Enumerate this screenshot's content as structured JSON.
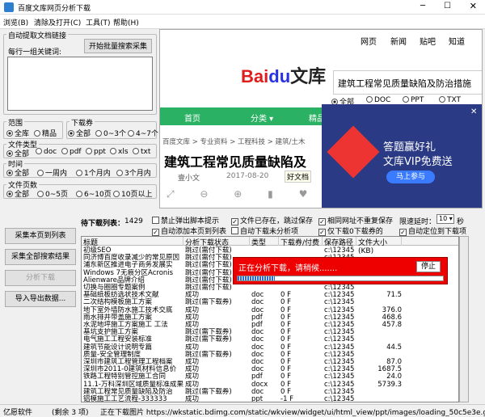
{
  "window": {
    "title": "百度文库网页分析下载"
  },
  "menu": [
    "浏览(B)",
    "清除及打开(C)",
    "工具(T)",
    "帮助(H)"
  ],
  "left": {
    "auto_group": "自动提取文档链接",
    "keyword_label": "每行一组关键词:",
    "batch_btn": "开始批量搜索采集",
    "range_group": "范围",
    "range_opts": [
      "全库",
      "精品"
    ],
    "coupon_group": "下载券",
    "coupon_opts": [
      "全部",
      "0~3个",
      "4~7个"
    ],
    "type_group": "文件类型",
    "type_opts": [
      "全部",
      "doc",
      "pdf",
      "ppt",
      "xls",
      "txt"
    ],
    "time_group": "时间",
    "time_opts": [
      "全部",
      "一周内",
      "1个月内",
      "3个月内"
    ],
    "pages_group": "文件页数",
    "pages_opts": [
      "全部",
      "0~5页",
      "6~10页",
      "10页以上"
    ]
  },
  "browser": {
    "nav": [
      "网页",
      "新闻",
      "贴吧",
      "知道"
    ],
    "logo_a": "Bai",
    "logo_b": "du",
    "logo_c": "文库",
    "search": "建筑工程常见质量缺陷及防治措施",
    "filters": [
      "全部",
      "DOC",
      "PPT",
      "TXT"
    ],
    "green": [
      "首页",
      "分类 ▾",
      "精品"
    ],
    "crumb": "百度文库 > 专业资料 > 工程科技 > 建筑/土木",
    "doctitle": "建筑工程常见质量缺陷及",
    "author": "壹小文",
    "date": "2017-08-20",
    "doc_badge": "好文档",
    "ad_line1": "答题赢好礼",
    "ad_line2": "文库VIP免费送",
    "ad_btn": "马上参与"
  },
  "controls": {
    "btn_collect_page": "采集本页到列表",
    "btn_collect_all": "采集全部搜索结果",
    "btn_analyze": "分析下载",
    "btn_import": "导入导出数据...",
    "list_label": "待下载列表：",
    "list_count": "1429",
    "opt1": "禁止弹出脚本提示",
    "opt2": "文件已存在，跳过保存",
    "opt3": "相同网址不重复保存",
    "opt4": "自动添加本页到列表",
    "opt5": "自动下载未分析项",
    "opt6": "仅下载0下载券的",
    "opt7": "自动定位到下载项",
    "speed_label": "限速延时：",
    "speed_val": "10",
    "speed_unit": "秒"
  },
  "table": {
    "headers": [
      "标题",
      "分析下载状态",
      "类型",
      "下载券/付费",
      "保存路径",
      "文件大小(KB)"
    ],
    "rows": [
      [
        "初级SEO",
        "跳过(需付下载)",
        "",
        "",
        "c:\\12345",
        ""
      ],
      [
        "同济博百度收录减少的常见原因",
        "跳过(需付下载)",
        "",
        "",
        "c:\\12345",
        ""
      ],
      [
        "浦东新区推进电子商务发展实",
        "跳过(需付下载)",
        "",
        "",
        "c:\\12345",
        ""
      ],
      [
        "Windows 7无痕分区Acronis",
        "跳过(需付下载)",
        "",
        "",
        "c:\\12345",
        ""
      ],
      [
        "Alienware品牌介绍",
        "跳过(需付下载)",
        "",
        "",
        "c:\\12345",
        ""
      ],
      [
        "切换与圈圈专题案例",
        "跳过(需付下载)",
        "",
        "",
        "c:\\12345",
        ""
      ],
      [
        "基础纸板纺选状技术文献",
        "成功",
        "doc",
        "0 F",
        "c:\\12345",
        "71.5"
      ],
      [
        "二次结构模板施工方案",
        "跳过(需下载券)",
        "doc",
        "0 F",
        "c:\\12345",
        ""
      ],
      [
        "地下室外墙防水施工技术交底",
        "成功",
        "doc",
        "0 F",
        "c:\\12345",
        "376.0"
      ],
      [
        "雨水排井带盖施工方案",
        "成功",
        "pdf",
        "0 F",
        "c:\\12345",
        "468.6"
      ],
      [
        "水泥地坪施工方案施工 工法",
        "成功",
        "pdf",
        "0 F",
        "c:\\12345",
        "457.8"
      ],
      [
        "基坑支护施工方案",
        "跳过(需下载券)",
        "doc",
        "0 F",
        "c:\\12345",
        ""
      ],
      [
        "电气施工工程安装标准",
        "跳过(需下载券)",
        "doc",
        "0 F",
        "c:\\12345",
        ""
      ],
      [
        "建筑节能设计说明专篇",
        "成功",
        "doc",
        "0 F",
        "c:\\12345",
        "44.5"
      ],
      [
        "质量-安全管理制度",
        "跳过(需下载券)",
        "doc",
        "0 F",
        "c:\\12345",
        ""
      ],
      [
        "深圳市建筑工程管理工程档案",
        "成功",
        "doc",
        "0 F",
        "c:\\12345",
        "87.0"
      ],
      [
        "深圳市2011-0建筑材料信息价",
        "成功",
        "doc",
        "0 F",
        "c:\\12345",
        "1687.5"
      ],
      [
        "铁路工程特别管控施工合同",
        "成功",
        "pdf",
        "0 F",
        "c:\\12345",
        "24.0"
      ],
      [
        "11.1-万科深圳区域质量标准成果",
        "成功",
        "docx",
        "0 F",
        "c:\\12345",
        "5739.3"
      ],
      [
        "建筑工程常见质量缺陷及防治",
        "跳过(需下载券)",
        "doc",
        "0 F",
        "c:\\12345",
        ""
      ],
      [
        "铝模施工工艺流程-333333",
        "成功",
        "ppt",
        "-1 F",
        "c:\\12345",
        ""
      ]
    ]
  },
  "progress": {
    "text": "正在分析下载，请稍候.......",
    "stop": "停止",
    "fraction": 0.18
  },
  "status": {
    "company": "亿愿软件",
    "remaining": "(剩余 3 项)",
    "url": "正在下载图片 https://wkstatic.bdimg.com/static/wkview/widget/ui/html_view/ppt/images/loading_50c5e3e.gif"
  }
}
